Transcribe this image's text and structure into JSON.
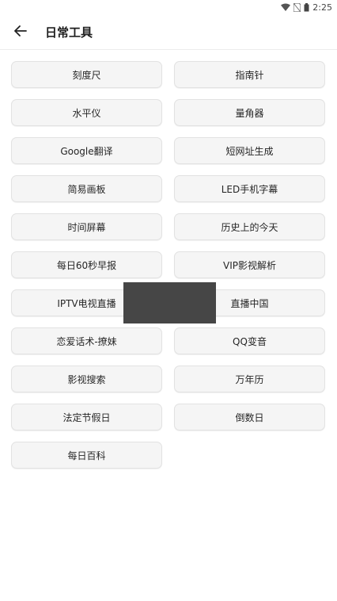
{
  "status_bar": {
    "time": "2:25"
  },
  "app_bar": {
    "title": "日常工具",
    "back_icon": "arrow-left-icon"
  },
  "tools": [
    "刻度尺",
    "指南针",
    "水平仪",
    "量角器",
    "Google翻译",
    "短网址生成",
    "简易画板",
    "LED手机字幕",
    "时间屏幕",
    "历史上的今天",
    "每日60秒早报",
    "VIP影视解析",
    "IPTV电视直播",
    "直播中国",
    "恋爱话术-撩妹",
    "QQ变音",
    "影视搜索",
    "万年历",
    "法定节假日",
    "倒数日",
    "每日百科"
  ]
}
